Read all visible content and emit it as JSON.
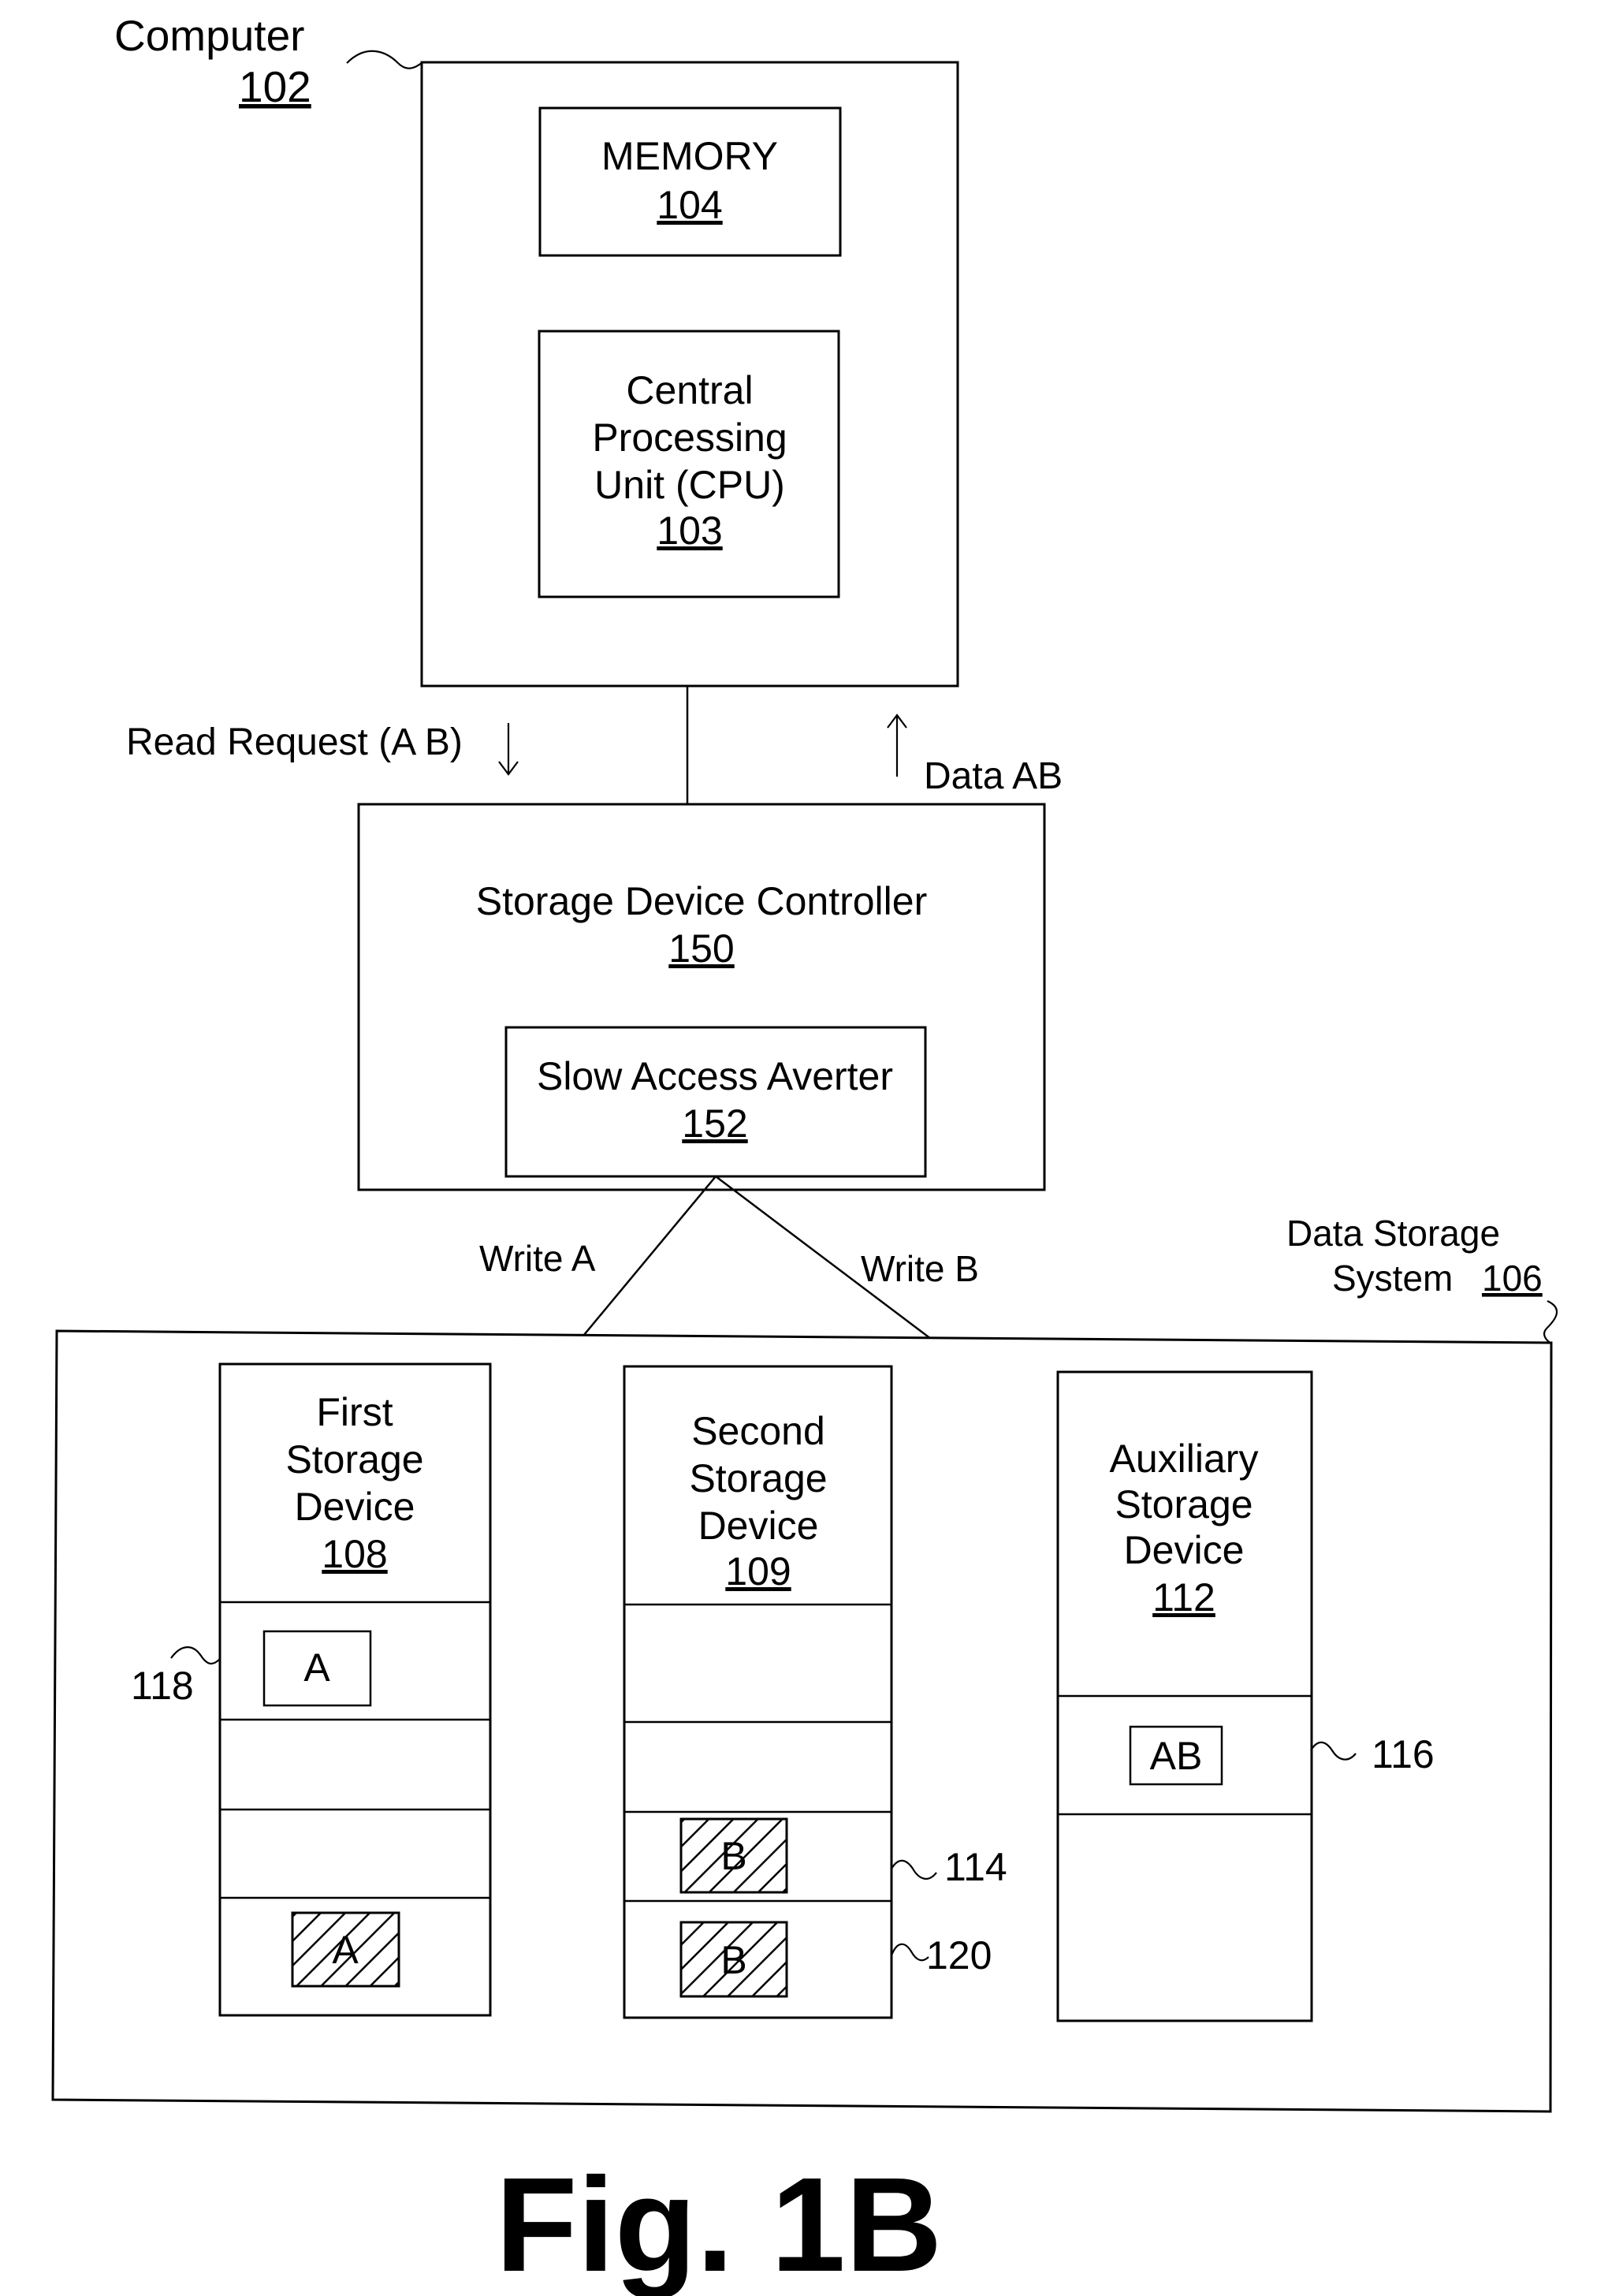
{
  "figure": {
    "caption": "Fig. 1B",
    "colors": {
      "ink": "#000000",
      "paper": "#ffffff"
    }
  },
  "computer": {
    "label": "Computer",
    "ref": "102",
    "memory": {
      "label": "MEMORY",
      "ref": "104"
    },
    "cpu": {
      "lines": [
        "Central",
        "Processing",
        "Unit (CPU)"
      ],
      "ref": "103"
    }
  },
  "signals": {
    "read_request": "Read Request (A B)",
    "data_return": "Data AB"
  },
  "controller": {
    "label": "Storage Device Controller",
    "ref": "150",
    "averter": {
      "label": "Slow Access Averter",
      "ref": "152"
    }
  },
  "writes": {
    "write_a": "Write A",
    "write_b": "Write B"
  },
  "data_storage_system": {
    "lines": [
      "Data Storage",
      "System"
    ],
    "ref": "106",
    "devices": [
      {
        "lines": [
          "First",
          "Storage",
          "Device"
        ],
        "ref": "108",
        "blocks": [
          {
            "label": "A",
            "style": "plain"
          },
          {
            "label": "",
            "style": "empty"
          },
          {
            "label": "",
            "style": "empty"
          },
          {
            "label": "A",
            "style": "hatched"
          }
        ],
        "callout": "118"
      },
      {
        "lines": [
          "Second",
          "Storage",
          "Device"
        ],
        "ref": "109",
        "blocks": [
          {
            "label": "",
            "style": "empty"
          },
          {
            "label": "",
            "style": "empty"
          },
          {
            "label": "B",
            "style": "hatched"
          },
          {
            "label": "B",
            "style": "hatched"
          }
        ],
        "callouts": [
          "114",
          "120"
        ]
      },
      {
        "lines": [
          "Auxiliary",
          "Storage",
          "Device"
        ],
        "ref": "112",
        "blocks": [
          {
            "label": "AB",
            "style": "plain"
          },
          {
            "label": "",
            "style": "empty"
          }
        ],
        "callout": "116"
      }
    ]
  }
}
